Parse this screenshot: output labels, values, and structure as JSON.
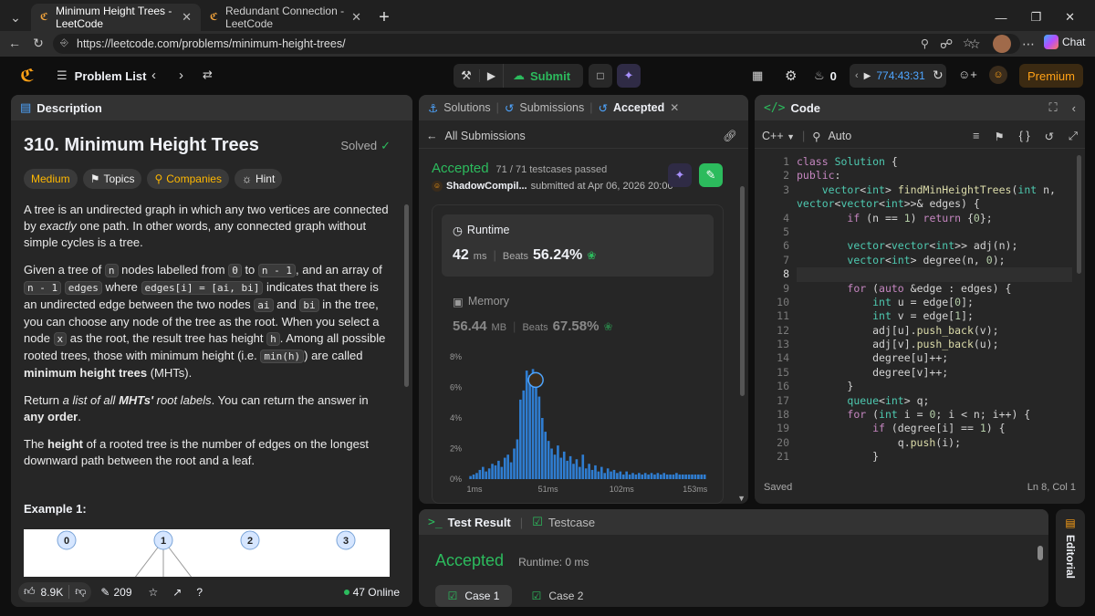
{
  "browser": {
    "tabs": [
      {
        "title": "Minimum Height Trees - LeetCode",
        "active": true
      },
      {
        "title": "Redundant Connection - LeetCode",
        "active": false
      }
    ],
    "url": "https://leetcode.com/problems/minimum-height-trees/",
    "chat_label": "Chat"
  },
  "nav": {
    "problem_list": "Problem List",
    "submit": "Submit",
    "streak": "0",
    "timer": "774:43:31",
    "premium": "Premium"
  },
  "description": {
    "tab": "Description",
    "title": "310. Minimum Height Trees",
    "status": "Solved",
    "tags": {
      "difficulty": "Medium",
      "topics": "Topics",
      "companies": "Companies",
      "hint": "Hint"
    },
    "p1": {
      "a": "A tree is an undirected graph in which any two vertices are connected by ",
      "b": "exactly",
      "c": " one path. In other words, any connected graph without simple cycles is a tree."
    },
    "p2": {
      "a": "Given a tree of ",
      "n": "n",
      "b": " nodes labelled from ",
      "zero": "0",
      "c": " to ",
      "nm1": "n - 1",
      "d": ", and an array of ",
      "nm1b": "n - 1",
      "e": " ",
      "edges": "edges",
      "f": " where ",
      "edgesi": "edges[i] = [ai, bi]",
      "g": " indicates that there is an undirected edge between the two nodes ",
      "ai": "ai",
      "h": " and ",
      "bi": "bi",
      "i": " in the tree, you can choose any node of the tree as the root. When you select a node ",
      "x": "x",
      "j": " as the root, the result tree has height ",
      "hh": "h",
      "k": ". Among all possible rooted trees, those with minimum height (i.e. ",
      "minh": "min(h)",
      "l": ")  are called ",
      "m": "minimum height trees",
      "o": " (MHTs)."
    },
    "p3": {
      "a": "Return ",
      "b": "a list of all ",
      "c": "MHTs'",
      "d": " root labels",
      "e": ". You can return the answer in ",
      "f": "any order",
      "g": "."
    },
    "p4": {
      "a": "The ",
      "b": "height",
      "c": " of a rooted tree is the number of edges on the longest downward path between the root and a leaf."
    },
    "example_title": "Example 1:",
    "example_nodes": [
      "0",
      "1",
      "2",
      "3"
    ],
    "footer": {
      "likes": "8.9K",
      "comments": "209",
      "online": "47 Online"
    }
  },
  "submission": {
    "tabs": {
      "solutions": "Solutions",
      "submissions": "Submissions",
      "accepted": "Accepted"
    },
    "back": "All Submissions",
    "verdict": "Accepted",
    "testcases": "71 / 71 testcases passed",
    "user": "ShadowCompil...",
    "submitted": "submitted at Apr 06, 2026 20:00",
    "runtime": {
      "label": "Runtime",
      "value": "42",
      "unit": "ms",
      "beats_label": "Beats",
      "beats": "56.24%"
    },
    "memory": {
      "label": "Memory",
      "value": "56.44",
      "unit": "MB",
      "beats_label": "Beats",
      "beats": "67.58%"
    }
  },
  "chart_data": {
    "type": "bar",
    "title": "",
    "xlabel": "",
    "ylabel": "",
    "x_ticks": [
      "1ms",
      "51ms",
      "102ms",
      "153ms"
    ],
    "y_ticks": [
      "0%",
      "2%",
      "4%",
      "6%",
      "8%"
    ],
    "ylim": [
      0,
      8
    ],
    "bar_color": "#2f7dd1",
    "values": [
      0.2,
      0.3,
      0.4,
      0.6,
      0.8,
      0.5,
      0.7,
      1.0,
      0.9,
      1.2,
      0.8,
      1.4,
      1.6,
      1.1,
      2.0,
      2.6,
      5.2,
      5.8,
      7.1,
      6.8,
      7.2,
      6.5,
      5.4,
      4.0,
      3.1,
      2.5,
      2.0,
      1.6,
      2.2,
      1.4,
      1.8,
      1.2,
      1.5,
      1.0,
      1.3,
      0.8,
      1.6,
      0.7,
      1.0,
      0.6,
      0.9,
      0.5,
      0.8,
      0.4,
      0.7,
      0.5,
      0.6,
      0.4,
      0.5,
      0.3,
      0.5,
      0.3,
      0.4,
      0.3,
      0.4,
      0.3,
      0.4,
      0.3,
      0.4,
      0.3,
      0.4,
      0.3,
      0.4,
      0.3,
      0.3,
      0.3,
      0.4,
      0.3,
      0.3,
      0.3,
      0.3,
      0.3,
      0.3,
      0.3,
      0.3,
      0.3
    ]
  },
  "code": {
    "tab": "Code",
    "lang": "C++",
    "mode": "Auto",
    "lines": [
      "class Solution {",
      "public:",
      "    vector<int> findMinHeightTrees(int n,",
      "vector<vector<int>>& edges) {",
      "        if (n == 1) return {0};",
      "",
      "        vector<vector<int>> adj(n);",
      "        vector<int> degree(n, 0);",
      "",
      "        for (auto &edge : edges) {",
      "            int u = edge[0];",
      "            int v = edge[1];",
      "            adj[u].push_back(v);",
      "            adj[v].push_back(u);",
      "            degree[u]++;",
      "            degree[v]++;",
      "        }",
      "        queue<int> q;",
      "        for (int i = 0; i < n; i++) {",
      "            if (degree[i] == 1) {",
      "                q.push(i);",
      "            }"
    ],
    "line_numbers": [
      "1",
      "2",
      "3",
      "",
      "4",
      "5",
      "6",
      "7",
      "8",
      "9",
      "10",
      "11",
      "12",
      "13",
      "14",
      "15",
      "16",
      "17",
      "18",
      "19",
      "20",
      "21"
    ],
    "saved": "Saved",
    "cursor": "Ln 8, Col 1"
  },
  "result": {
    "tab": "Test Result",
    "testcase_tab": "Testcase",
    "verdict": "Accepted",
    "runtime": "Runtime: 0 ms",
    "cases": [
      "Case 1",
      "Case 2"
    ]
  },
  "editorial": "Editorial",
  "colors": {
    "accent_green": "#2cbb5d",
    "accent_orange": "#ffa116",
    "medium": "#ffb800",
    "bg": "#0f0f0f",
    "panel": "#262626"
  }
}
